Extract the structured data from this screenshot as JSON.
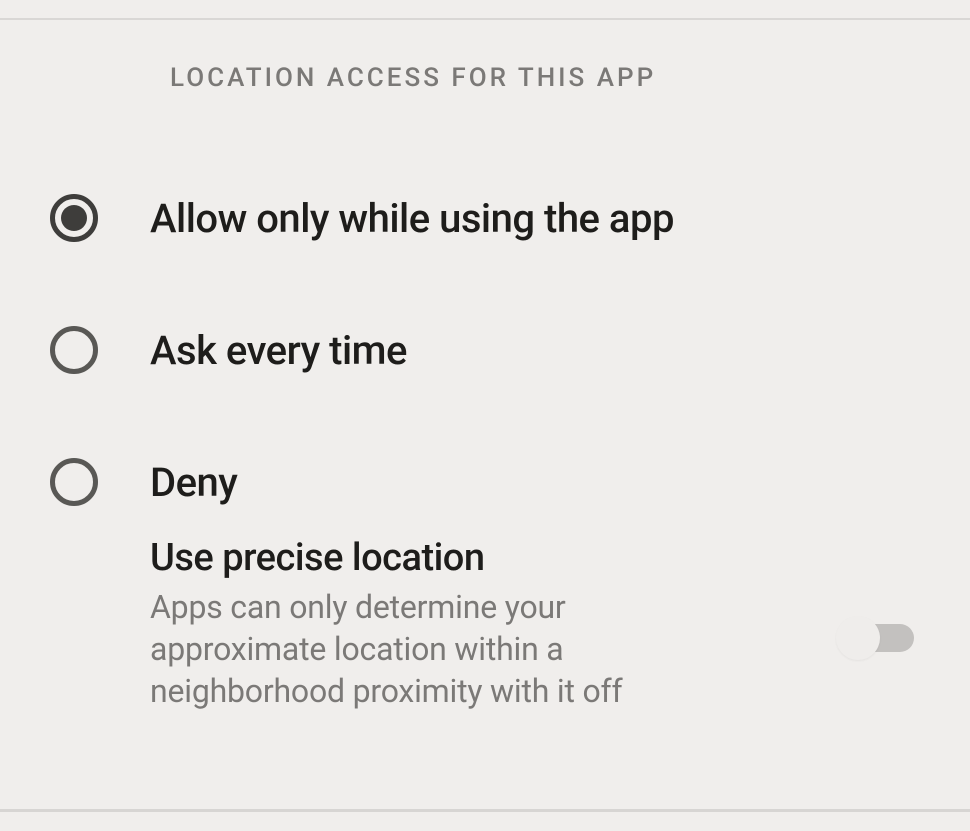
{
  "section_header": "LOCATION ACCESS FOR THIS APP",
  "options": [
    {
      "label": "Allow only while using the app",
      "selected": true
    },
    {
      "label": "Ask every time",
      "selected": false
    },
    {
      "label": "Deny",
      "selected": false
    }
  ],
  "precise": {
    "title": "Use precise location",
    "description": "Apps can only determine your approximate location within a neighborhood proximity with it off",
    "enabled": false
  }
}
